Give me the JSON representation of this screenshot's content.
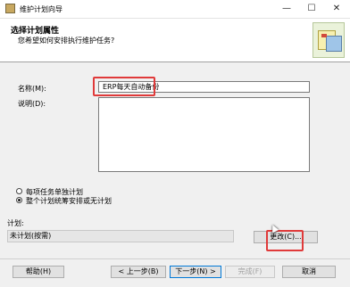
{
  "window": {
    "title": "维护计划向导",
    "controls": {
      "minimize": "—",
      "maximize": "☐",
      "close": "✕"
    }
  },
  "header": {
    "title": "选择计划属性",
    "subtitle": "您希望如何安排执行维护任务?"
  },
  "form": {
    "name_label": "名称(M):",
    "name_value": "ERP每天自动备份",
    "description_label": "说明(D):",
    "description_value": ""
  },
  "options": [
    {
      "label": "每项任务单独计划",
      "checked": false
    },
    {
      "label": "整个计划统筹安排或无计划",
      "checked": true
    }
  ],
  "schedule": {
    "label": "计划:",
    "value": "未计划(按需)",
    "change_button": "更改(C)..."
  },
  "footer": {
    "help": "帮助(H)",
    "back": "< 上一步(B)",
    "next": "下一步(N) >",
    "finish": "完成(F)",
    "cancel": "取消"
  },
  "highlight_color": "#e03a3a"
}
